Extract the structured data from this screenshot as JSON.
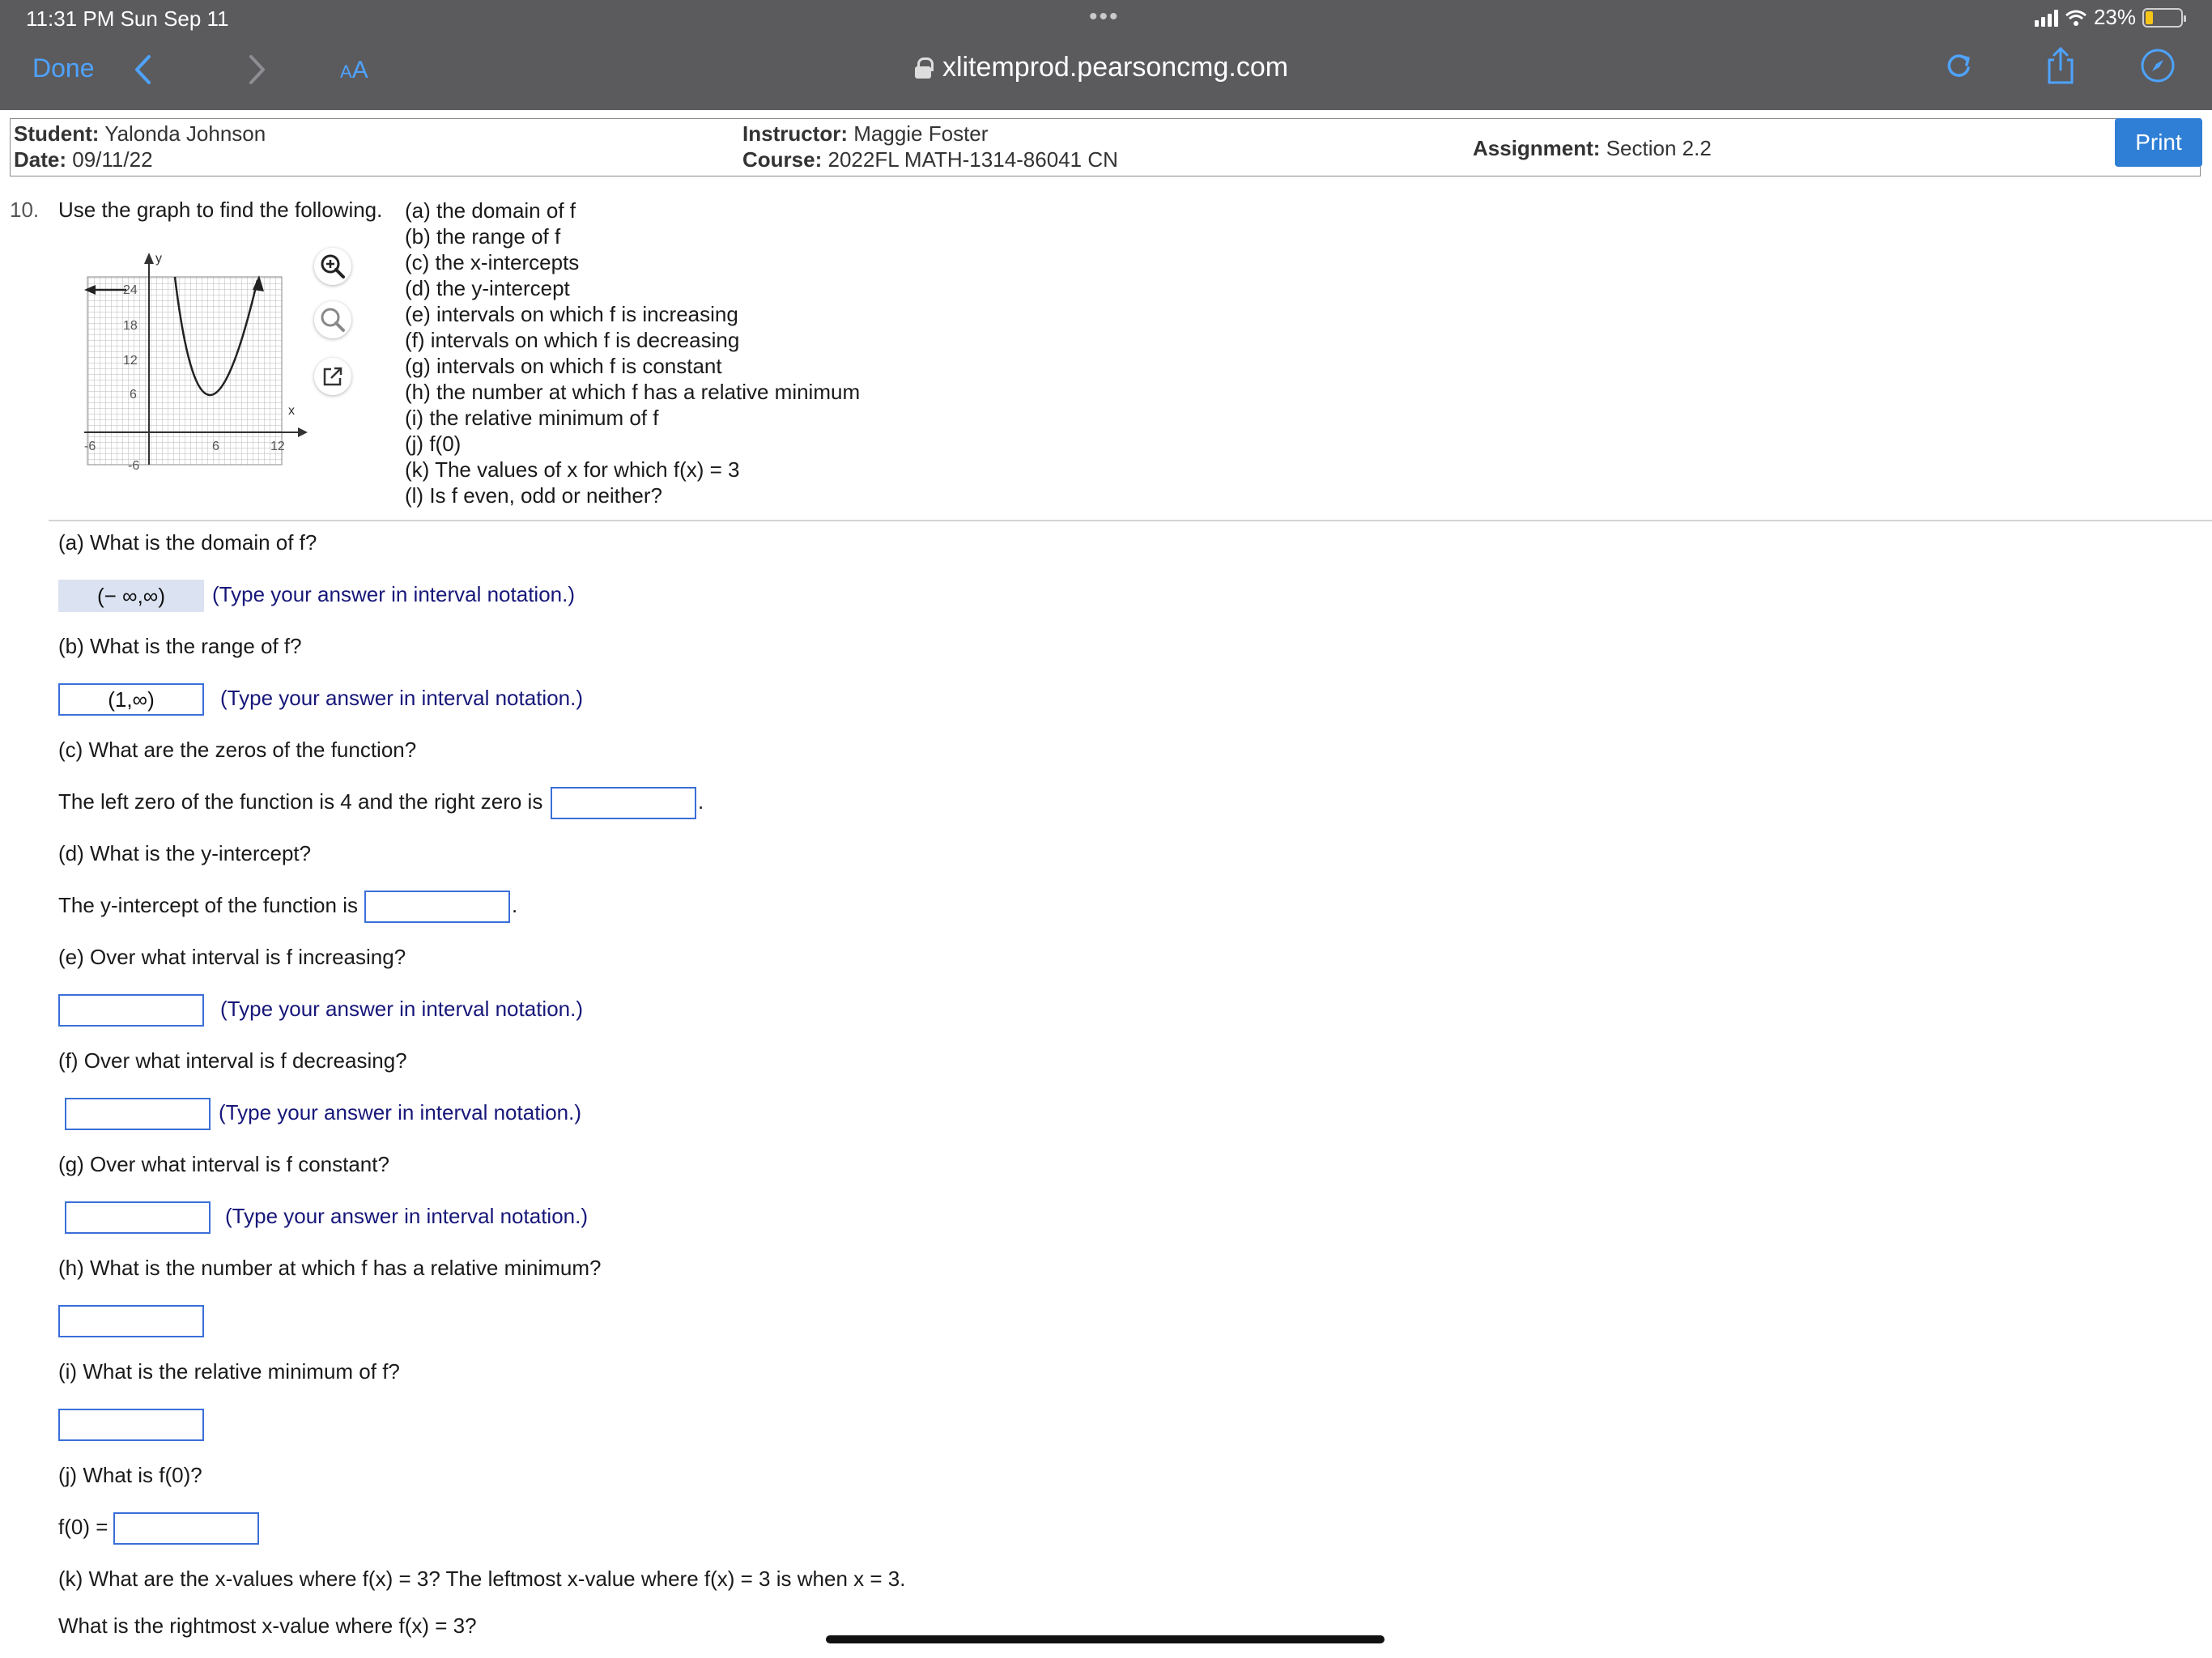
{
  "status": {
    "time": "11:31 PM   Sun Sep 11",
    "dots": "•••",
    "battery_pct": "23%"
  },
  "toolbar": {
    "done_label": "Done",
    "text_size_small": "A",
    "text_size_large": "A",
    "url": "xlitemprod.pearsoncmg.com",
    "accent_color": "#4ea3ff"
  },
  "header": {
    "student_label": "Student:",
    "student_name": "Yalonda Johnson",
    "date_label": "Date:",
    "date_value": "09/11/22",
    "instructor_label": "Instructor:",
    "instructor_name": "Maggie Foster",
    "course_label": "Course:",
    "course_value": "2022FL MATH-1314-86041 CN",
    "assignment_label": "Assignment:",
    "assignment_value": "Section 2.2",
    "print_label": "Print"
  },
  "question": {
    "number": "10.",
    "intro": "Use the graph to find the following.",
    "parts": [
      "(a) the domain of f",
      "(b) the range of f",
      "(c) the x-intercepts",
      "(d) the y-intercept",
      "(e) intervals on which f is increasing",
      "(f) intervals on which f is decreasing",
      "(g) intervals on which f is constant",
      "(h) the number at which f has a relative minimum",
      "(i) the relative minimum of f",
      "(j) f(0)",
      "(k) The values of x for which f(x) = 3",
      "(l) Is f even, odd or neither?"
    ]
  },
  "graph": {
    "y_axis_label": "y",
    "x_axis_label": "x",
    "y_ticks": [
      "24",
      "18",
      "12",
      "6",
      "-6"
    ],
    "x_ticks": [
      "-6",
      "6",
      "12"
    ]
  },
  "answers": {
    "a": {
      "prompt": "(a) What is the domain of f?",
      "value": "(− ∞,∞)",
      "hint": "(Type your answer in interval notation.)"
    },
    "b": {
      "prompt": "(b) What is the range of f?",
      "value": "(1,∞)",
      "hint": "(Type your answer in interval notation.)"
    },
    "c": {
      "prompt": "(c) What are the zeros of the function?",
      "sentence": "The left zero of the function is 4 and the right zero is",
      "value": ""
    },
    "d": {
      "prompt": "(d) What is the y-intercept?",
      "sentence": "The y-intercept of the function is",
      "value": ""
    },
    "e": {
      "prompt": "(e)  Over what interval is f increasing?",
      "value": "",
      "hint": "(Type your answer in interval notation.)"
    },
    "f": {
      "prompt": "(f) Over what interval is f decreasing?",
      "value": "",
      "hint": "(Type your answer in interval notation.)"
    },
    "g": {
      "prompt": "(g) Over what interval is f constant?",
      "value": "",
      "hint": "(Type your answer in interval notation.)"
    },
    "h": {
      "prompt": "(h) What is the number at which f has a relative minimum?",
      "value": ""
    },
    "i": {
      "prompt": "(i) What is the relative minimum of f?",
      "value": ""
    },
    "j": {
      "prompt": "(j)  What is f(0)?",
      "lead": "f(0) =",
      "value": ""
    },
    "k": {
      "prompt": "(k) What are the x-values where f(x) = 3?  The leftmost x-value where f(x) = 3 is when x = 3.",
      "follow": "What is the rightmost x-value where f(x) = 3?"
    }
  }
}
